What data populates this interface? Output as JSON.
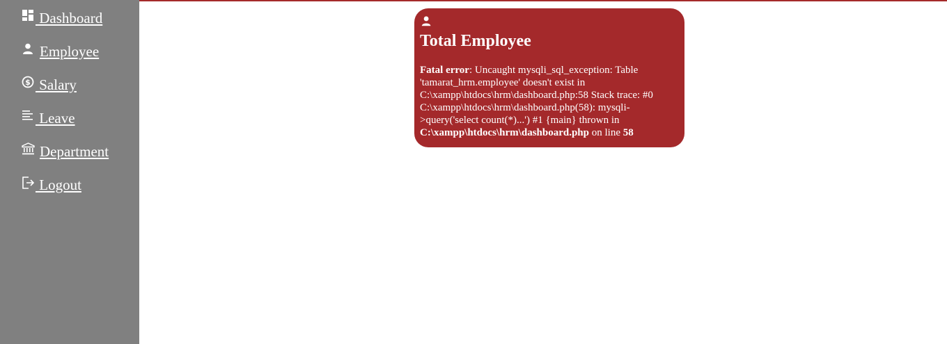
{
  "sidebar": {
    "items": [
      {
        "label": " Dashboard",
        "icon": "dashboard-icon"
      },
      {
        "label": "Employee",
        "icon": "person-icon"
      },
      {
        "label": " Salary",
        "icon": "dollar-circle-icon"
      },
      {
        "label": " Leave",
        "icon": "notes-icon"
      },
      {
        "label": "Department",
        "icon": "bank-icon"
      },
      {
        "label": " Logout",
        "icon": "logout-icon"
      }
    ]
  },
  "card": {
    "icon": "person-icon",
    "title": "Total Employee",
    "error": {
      "prefix": "Fatal error",
      "message": ": Uncaught mysqli_sql_exception: Table 'tamarat_hrm.employee' doesn't exist in C:\\xampp\\htdocs\\hrm\\dashboard.php:58 Stack trace: #0 C:\\xampp\\htdocs\\hrm\\dashboard.php(58): mysqli->query('select count(*)...') #1 {main} thrown in ",
      "file": "C:\\xampp\\htdocs\\hrm\\dashboard.php",
      "on_line_text": " on line ",
      "line": "58"
    }
  },
  "colors": {
    "sidebar_bg": "#808080",
    "card_bg": "#a4292b",
    "accent_line": "#a52a2a",
    "text": "#ffffff"
  }
}
